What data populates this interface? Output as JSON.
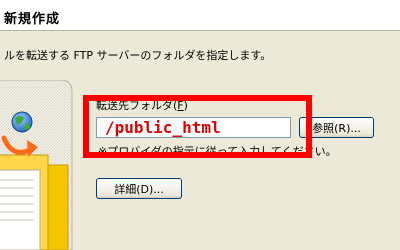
{
  "wizard": {
    "title": "新規作成",
    "instruction": "ルを転送する FTP サーバーのフォルダを指定します。"
  },
  "destination": {
    "label_prefix": "転送先フォルダ(",
    "label_mnemonic": "F",
    "label_suffix": ")",
    "path_value": "/public_html",
    "hint": "※プロバイダの指示に従って入力してください。"
  },
  "buttons": {
    "browse": "参照(R)...",
    "details": "詳細(D)..."
  },
  "colors": {
    "annotation": "#ff0000",
    "path_text": "#e00000",
    "dialog_bg": "#ece9d8"
  },
  "icons": {
    "globe": "globe-icon",
    "arrow": "curved-arrow-icon",
    "folder": "folder-icon"
  }
}
